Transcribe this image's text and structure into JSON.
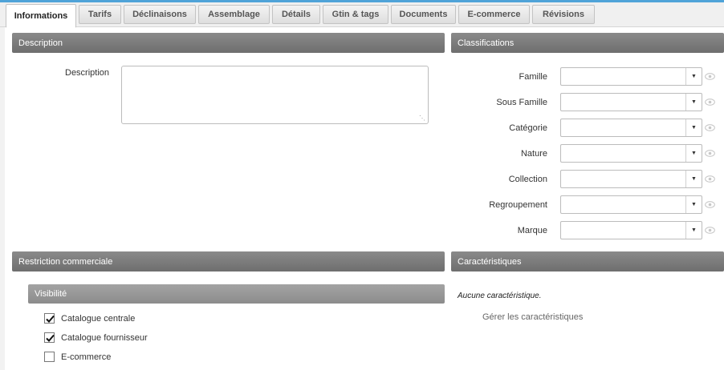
{
  "tabs": [
    {
      "label": "Informations",
      "active": true
    },
    {
      "label": "Tarifs"
    },
    {
      "label": "Déclinaisons"
    },
    {
      "label": "Assemblage"
    },
    {
      "label": "Détails"
    },
    {
      "label": "Gtin & tags"
    },
    {
      "label": "Documents"
    },
    {
      "label": "E-commerce"
    },
    {
      "label": "Révisions"
    }
  ],
  "description_panel": {
    "title": "Description",
    "field_label": "Description",
    "value": ""
  },
  "classifications_panel": {
    "title": "Classifications",
    "fields": [
      {
        "label": "Famille",
        "value": ""
      },
      {
        "label": "Sous Famille",
        "value": ""
      },
      {
        "label": "Catégorie",
        "value": ""
      },
      {
        "label": "Nature",
        "value": ""
      },
      {
        "label": "Collection",
        "value": ""
      },
      {
        "label": "Regroupement",
        "value": ""
      },
      {
        "label": "Marque",
        "value": ""
      }
    ]
  },
  "restriction_panel": {
    "title": "Restriction commerciale",
    "visibility_title": "Visibilité",
    "options": [
      {
        "label": "Catalogue centrale",
        "checked": true
      },
      {
        "label": "Catalogue fournisseur",
        "checked": true
      },
      {
        "label": "E-commerce",
        "checked": false
      }
    ]
  },
  "characteristics_panel": {
    "title": "Caractéristiques",
    "empty_text": "Aucune caractéristique.",
    "manage_link": "Gérer les caractéristiques"
  },
  "icons": {
    "select_arrow": "caret-down-icon",
    "visibility": "eye-icon",
    "check": "check-icon",
    "resize": "resize-grip-icon"
  },
  "colors": {
    "panel_header": "#7b7b7b",
    "sub_header": "#979797",
    "top_accent": "#4fa3d8"
  }
}
